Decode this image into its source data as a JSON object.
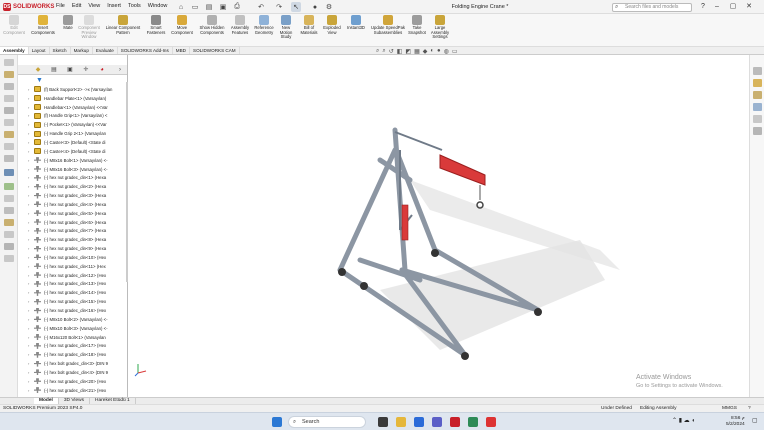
{
  "app": {
    "name": "SOLIDWORKS",
    "document_title": "Folding Engine Crane *"
  },
  "menu": [
    "File",
    "Edit",
    "View",
    "Insert",
    "Tools",
    "Window"
  ],
  "search": {
    "placeholder": "Search files and models"
  },
  "ribbon": [
    {
      "label": "Edit Component",
      "enabled": false
    },
    {
      "label": "Insert Components",
      "enabled": true
    },
    {
      "label": "Mate",
      "enabled": true
    },
    {
      "label": "Component Preview Window",
      "enabled": false
    },
    {
      "label": "Linear Component Pattern",
      "enabled": true
    },
    {
      "label": "Smart Fasteners",
      "enabled": true
    },
    {
      "label": "Move Component",
      "enabled": true
    },
    {
      "label": "Show Hidden Components",
      "enabled": true
    },
    {
      "label": "Assembly Features",
      "enabled": true
    },
    {
      "label": "Reference Geometry",
      "enabled": true
    },
    {
      "label": "New Motion Study",
      "enabled": true
    },
    {
      "label": "Bill of Materials",
      "enabled": true
    },
    {
      "label": "Exploded View",
      "enabled": true
    },
    {
      "label": "Instant3D",
      "enabled": true
    },
    {
      "label": "Update SpeedPak Subassemblies",
      "enabled": true
    },
    {
      "label": "Take Snapshot",
      "enabled": true
    },
    {
      "label": "Large Assembly Settings",
      "enabled": true
    }
  ],
  "tabs": [
    "Assembly",
    "Layout",
    "Sketch",
    "Markup",
    "Evaluate",
    "SOLIDWORKS Add-Ins",
    "MBD",
    "SOLIDWORKS CAM"
  ],
  "active_tab": "Assembly",
  "tree_items": [
    {
      "icon": "part",
      "label": "(f) Back Support<2> ->x (Varsayılan"
    },
    {
      "icon": "part",
      "label": "Handlebar Plate<1> (Varsayılan)"
    },
    {
      "icon": "part",
      "label": "Handlebar<1> (Varsayılan) <<Var"
    },
    {
      "icon": "part",
      "label": "(f) Handle Grip<1> (Varsayılan) <"
    },
    {
      "icon": "part",
      "label": "(-) Pocket<1> (Varsayılan) <<Var"
    },
    {
      "icon": "part",
      "label": "(-) Handle Grip 2<1> (Varsayılan"
    },
    {
      "icon": "part",
      "label": "(-) Caster<3> (Default) <State di"
    },
    {
      "icon": "part",
      "label": "(-) Caster<4> (Default) <State di"
    },
    {
      "icon": "bolt",
      "label": "(-) M8x16 Bolt<1> (Varsayılan) <-"
    },
    {
      "icon": "bolt",
      "label": "(-) M8x16 Bolt<3> (Varsayılan) <-"
    },
    {
      "icon": "bolt",
      "label": "(-) hex nut gradec_din<1> (Hexa"
    },
    {
      "icon": "bolt",
      "label": "(-) hex nut gradec_din<2> (Hexa"
    },
    {
      "icon": "bolt",
      "label": "(-) hex nut gradec_din<3> (Hexa"
    },
    {
      "icon": "bolt",
      "label": "(-) hex nut gradec_din<4> (Hexa"
    },
    {
      "icon": "bolt",
      "label": "(-) hex nut gradec_din<5> (Hexa"
    },
    {
      "icon": "bolt",
      "label": "(-) hex nut gradec_din<6> (Hexa"
    },
    {
      "icon": "bolt",
      "label": "(-) hex nut gradec_din<7> (Hexa"
    },
    {
      "icon": "bolt",
      "label": "(-) hex nut gradec_din<8> (Hexa"
    },
    {
      "icon": "bolt",
      "label": "(-) hex nut gradec_din<9> (Hexa"
    },
    {
      "icon": "bolt",
      "label": "(-) hex nut gradec_din<10> (Hex"
    },
    {
      "icon": "bolt",
      "label": "(-) hex nut gradec_din<11> (Hex"
    },
    {
      "icon": "bolt",
      "label": "(-) hex nut gradec_din<12> (Hex"
    },
    {
      "icon": "bolt",
      "label": "(-) hex nut gradec_din<13> (Hex"
    },
    {
      "icon": "bolt",
      "label": "(-) hex nut gradec_din<14> (Hex"
    },
    {
      "icon": "bolt",
      "label": "(-) hex nut gradec_din<15> (Hex"
    },
    {
      "icon": "bolt",
      "label": "(-) hex nut gradec_din<16> (Hex"
    },
    {
      "icon": "bolt",
      "label": "(-) M8x10 Bolt<2> (Varsayılan) <-"
    },
    {
      "icon": "bolt",
      "label": "(-) M8x10 Bolt<3> (Varsayılan) <-"
    },
    {
      "icon": "bolt",
      "label": "(-) M16x120 Bolt<1> (Varsayılan"
    },
    {
      "icon": "bolt",
      "label": "(-) hex nut gradec_din<17> (Hex"
    },
    {
      "icon": "bolt",
      "label": "(-) hex nut gradec_din<18> (Hex"
    },
    {
      "icon": "bolt",
      "label": "(-) hex bolt gradec_din<3> (DIN 9"
    },
    {
      "icon": "bolt",
      "label": "(-) hex bolt gradec_din<4> (DIN 9"
    },
    {
      "icon": "bolt",
      "label": "(-) hex nut gradec_din<20> (Hex"
    },
    {
      "icon": "bolt",
      "label": "(-) hex nut gradec_din<21> (Hex"
    }
  ],
  "bottom_tabs": [
    "Model",
    "3D Views",
    "Hareket Etüdü 1"
  ],
  "active_bottom_tab": "Model",
  "status": {
    "left": "SOLIDWORKS Premium 2023 SP4.0",
    "under_defined": "Under Defined",
    "mode": "Editing Assembly",
    "units": "MMGS"
  },
  "watermark": {
    "title": "Activate Windows",
    "subtitle": "Go to Settings to activate Windows."
  },
  "taskbar": {
    "search": "Search",
    "time": "8:56 م",
    "date": "5/2/2024"
  },
  "colors": {
    "accent_red": "#c8202a",
    "crane_red": "#d93a3a",
    "crane_steel": "#9aa4b2"
  }
}
